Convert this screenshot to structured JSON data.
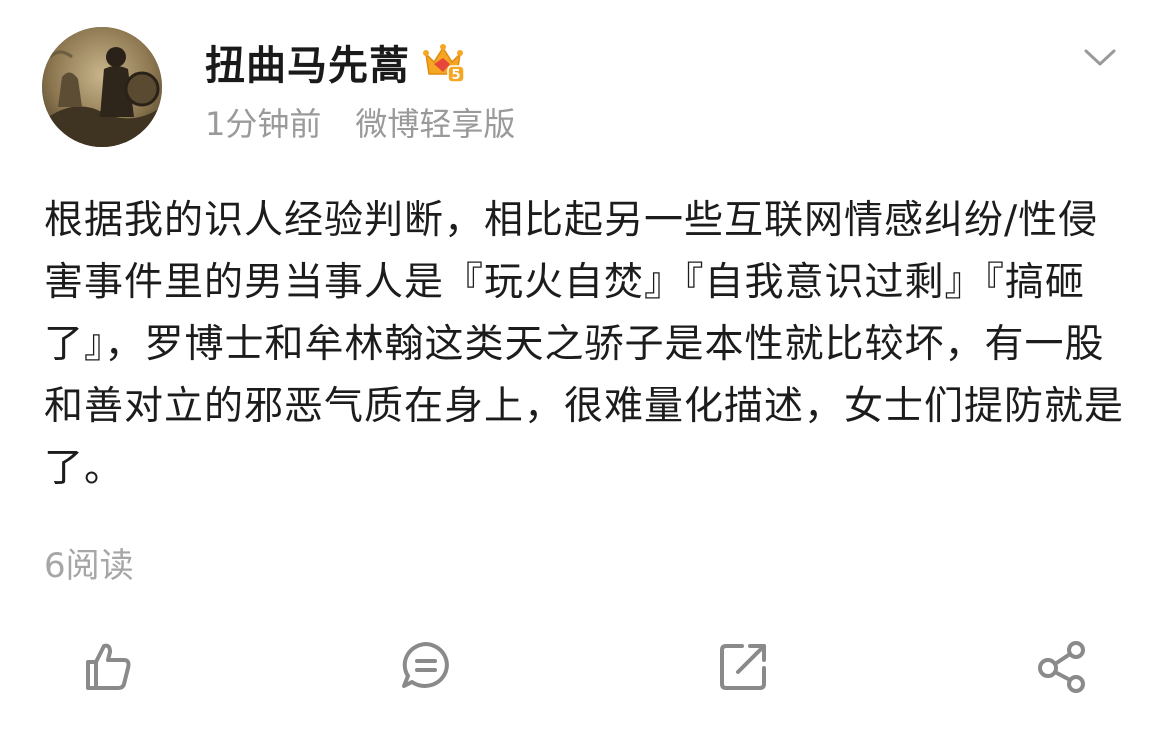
{
  "author": {
    "name": "扭曲马先蒿",
    "vip_level": "5",
    "avatar_icon": "avatar-image"
  },
  "meta": {
    "time": "1分钟前",
    "source": "微博轻享版"
  },
  "post": {
    "text": "根据我的识人经验判断，相比起另一些互联网情感纠纷/性侵害事件里的男当事人是『玩火自焚』『自我意识过剩』『搞砸了』，罗博士和牟林翰这类天之骄子是本性就比较坏，有一股和善对立的邪恶气质在身上，很难量化描述，女士们提防就是了。",
    "read_count": "6阅读"
  },
  "actions": [
    {
      "name": "like",
      "icon": "thumbs-up-icon"
    },
    {
      "name": "comment",
      "icon": "comment-icon"
    },
    {
      "name": "repost",
      "icon": "repost-icon"
    },
    {
      "name": "share",
      "icon": "share-icon"
    }
  ],
  "colors": {
    "text_primary": "#1c1c1c",
    "text_secondary": "#9a9a9a",
    "icon_gray": "#8a8a8a",
    "vip_gold": "#f5a623",
    "vip_red": "#e8463c"
  }
}
